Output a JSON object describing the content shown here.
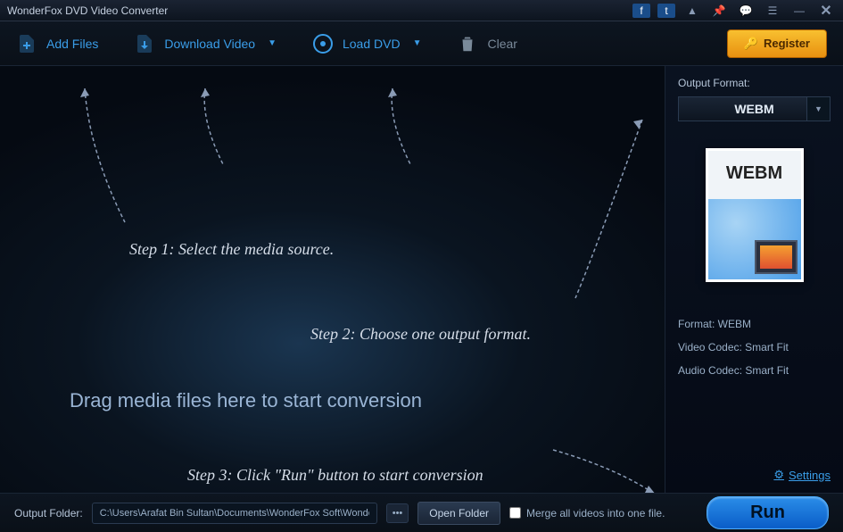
{
  "titlebar": {
    "title": "WonderFox DVD Video Converter"
  },
  "toolbar": {
    "add_files": "Add Files",
    "download_video": "Download Video",
    "load_dvd": "Load DVD",
    "clear": "Clear",
    "register": "Register"
  },
  "canvas": {
    "step1": "Step 1: Select the media source.",
    "step2": "Step 2: Choose one output format.",
    "step3": "Step 3: Click \"Run\" button to start conversion",
    "drag_hint": "Drag media files here to start conversion"
  },
  "sidebar": {
    "output_format_label": "Output Format:",
    "selected_format": "WEBM",
    "thumb_label": "WEBM",
    "format_meta": "Format: WEBM",
    "video_codec": "Video Codec: Smart Fit",
    "audio_codec": "Audio Codec: Smart Fit",
    "settings": "Settings"
  },
  "footer": {
    "output_folder_label": "Output Folder:",
    "path": "C:\\Users\\Arafat Bin Sultan\\Documents\\WonderFox Soft\\WonderFox DVD",
    "open_folder": "Open Folder",
    "merge_label": "Merge all videos into one file.",
    "run": "Run"
  }
}
